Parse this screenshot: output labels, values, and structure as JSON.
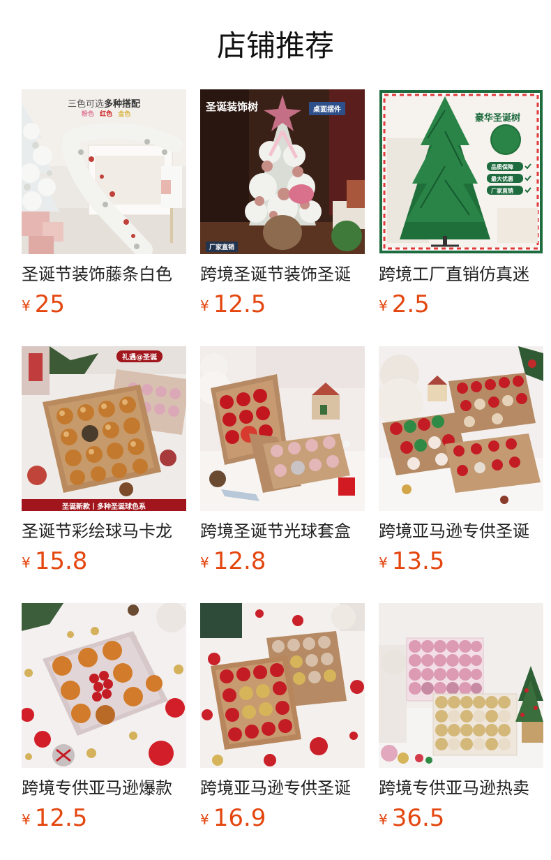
{
  "header": {
    "title": "店铺推荐"
  },
  "products": [
    {
      "name": "圣诞节装饰藤条白色",
      "currency": "¥",
      "price": "25",
      "image": "flocked-garland-photo",
      "image_text": {
        "line1": "三色可选",
        "line1b": "多种搭配",
        "chip1": "粉色",
        "chip2": "红色",
        "chip3": "金色"
      }
    },
    {
      "name": "跨境圣诞节装饰圣诞",
      "currency": "¥",
      "price": "12.5",
      "image": "tabletop-tree-photo",
      "image_text": {
        "title": "圣诞装饰树",
        "badge": "桌面摆件",
        "footer": "厂家直销"
      }
    },
    {
      "name": "跨境工厂直销仿真迷",
      "currency": "¥",
      "price": "2.5",
      "image": "green-tree-photo",
      "image_text": {
        "title": "豪华圣诞树",
        "b1": "品质保障",
        "b2": "最大优惠",
        "b3": "厂家直销"
      }
    },
    {
      "name": "圣诞节彩绘球马卡龙",
      "currency": "¥",
      "price": "15.8",
      "image": "gold-baubles-box-photo",
      "image_text": {
        "badge": "礼遇@圣诞",
        "footer": "圣诞新款丨多种圣诞球色系"
      }
    },
    {
      "name": "跨境圣诞节光球套盒",
      "currency": "¥",
      "price": "12.8",
      "image": "red-pink-ornament-box-photo"
    },
    {
      "name": "跨境亚马逊专供圣诞",
      "currency": "¥",
      "price": "13.5",
      "image": "red-green-ball-boxes-photo"
    },
    {
      "name": "跨境专供亚马逊爆款",
      "currency": "¥",
      "price": "12.5",
      "image": "gold-red-ball-box-photo"
    },
    {
      "name": "跨境亚马逊专供圣诞",
      "currency": "¥",
      "price": "16.9",
      "image": "red-gold-ball-boxes-photo"
    },
    {
      "name": "跨境专供亚马逊热卖",
      "currency": "¥",
      "price": "36.5",
      "image": "pink-gold-ball-boxes-photo"
    }
  ]
}
